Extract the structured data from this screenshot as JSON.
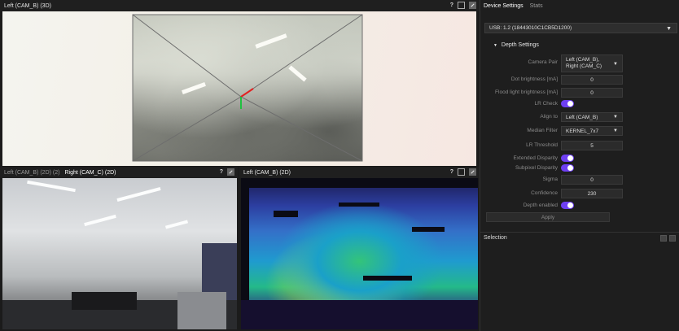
{
  "views": {
    "top_title": "Left (CAM_B) (3D)",
    "bottom_left_tab1": "Left (CAM_B) (2D) (2)",
    "bottom_left_tab2": "Right (CAM_C) (2D)",
    "bottom_right_title": "Left (CAM_B) (2D)",
    "help_glyph": "?"
  },
  "right_panel": {
    "tab_device": "Device Settings",
    "tab_stats": "Stats",
    "usb_label": "USB: 1.2 (18443010C1CB5D1200)",
    "section_title": "Depth Settings",
    "camera_pair_label": "Camera Pair",
    "camera_pair_value": "Left (CAM_B), Right (CAM_C)",
    "dot_label": "Dot brightness [mA]",
    "dot_value": "0",
    "flood_label": "Flood light brightness [mA]",
    "flood_value": "0",
    "lr_check_label": "LR Check",
    "align_label": "Align to",
    "align_value": "Left (CAM_B)",
    "median_label": "Median Filter",
    "median_value": "KERNEL_7x7",
    "lr_thresh_label": "LR Threshold",
    "lr_thresh_value": "5",
    "ext_disp_label": "Extended Disparity",
    "subpix_label": "Subpixel Disparity",
    "sigma_label": "Sigma",
    "sigma_value": "0",
    "conf_label": "Confidence",
    "conf_value": "230",
    "depth_en_label": "Depth enabled",
    "apply_label": "Apply",
    "selection_title": "Selection"
  },
  "colors": {
    "accent_toggle": "#6e3ff2"
  }
}
